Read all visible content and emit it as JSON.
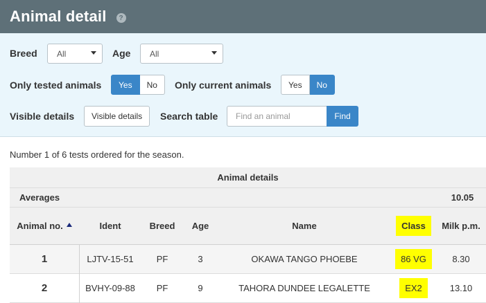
{
  "header": {
    "title": "Animal detail",
    "help_glyph": "?"
  },
  "filters": {
    "breed": {
      "label": "Breed",
      "value": "All"
    },
    "age": {
      "label": "Age",
      "value": "All"
    },
    "only_tested": {
      "label": "Only tested animals",
      "yes": "Yes",
      "no": "No",
      "selected": "Yes"
    },
    "only_current": {
      "label": "Only current animals",
      "yes": "Yes",
      "no": "No",
      "selected": "No"
    },
    "visible_details": {
      "label": "Visible details",
      "button": "Visible details"
    },
    "search": {
      "label": "Search table",
      "placeholder": "Find an animal",
      "button": "Find"
    }
  },
  "summary": "Number 1 of 6 tests ordered for the season.",
  "table": {
    "title": "Animal details",
    "averages": {
      "label": "Averages",
      "milk_pm": "10.05"
    },
    "columns": {
      "animal_no": "Animal no.",
      "ident": "Ident",
      "breed": "Breed",
      "age": "Age",
      "name": "Name",
      "class": "Class",
      "milk_pm": "Milk p.m."
    },
    "rows": [
      {
        "animal_no": "1",
        "ident": "LJTV-15-51",
        "breed": "PF",
        "age": "3",
        "name": "OKAWA TANGO PHOEBE",
        "class": "86 VG",
        "milk_pm": "8.30"
      },
      {
        "animal_no": "2",
        "ident": "BVHY-09-88",
        "breed": "PF",
        "age": "9",
        "name": "TAHORA DUNDEE LEGALETTE",
        "class": "EX2",
        "milk_pm": "13.10"
      }
    ]
  },
  "colors": {
    "header_bg": "#5e7078",
    "filter_bg": "#eaf6fc",
    "accent": "#3a86c8",
    "highlight": "#ffff00"
  },
  "icons": {
    "help": "help-icon",
    "sort": "sort-ascending-icon",
    "dropdown": "chevron-down-icon"
  }
}
